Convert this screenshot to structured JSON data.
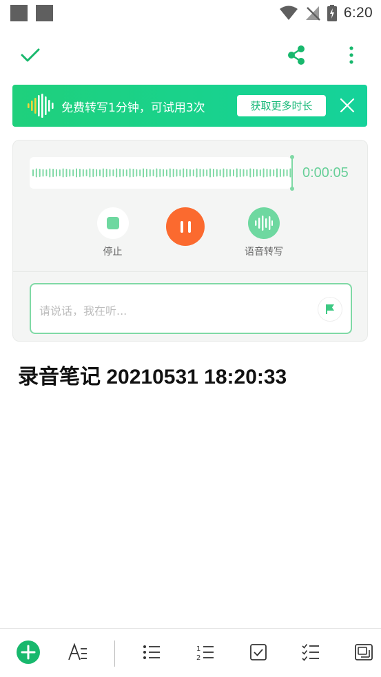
{
  "status_bar": {
    "time": "6:20",
    "icons": [
      "notification-square-icon",
      "notification-square-icon",
      "wifi-icon",
      "no-signal-icon",
      "battery-charging-icon"
    ]
  },
  "toolbar": {
    "icons": [
      "check-icon",
      "share-icon",
      "more-vertical-icon"
    ]
  },
  "promo": {
    "text": "免费转写1分钟，可试用3次",
    "button_label": "获取更多时长",
    "icons": [
      "soundwave-icon",
      "close-icon"
    ]
  },
  "recorder": {
    "timer": "0:00:05",
    "stop_label": "停止",
    "transcribe_label": "语音转写",
    "speech_placeholder": "请说话，我在听...",
    "icons": [
      "stop-icon",
      "pause-icon",
      "transcribe-icon",
      "flag-icon"
    ]
  },
  "note": {
    "title": "录音笔记 20210531 18:20:33"
  },
  "bottom_bar": {
    "icons": [
      "add-icon",
      "text-format-icon",
      "bulleted-list-icon",
      "numbered-list-icon",
      "checkbox-icon",
      "checklist-icon",
      "attachment-icon"
    ]
  },
  "colors": {
    "accent_green": "#1fd07c",
    "pause_orange": "#fb6a2f",
    "soft_green": "#6ed8a0",
    "promo_button_text": "#17b877"
  }
}
